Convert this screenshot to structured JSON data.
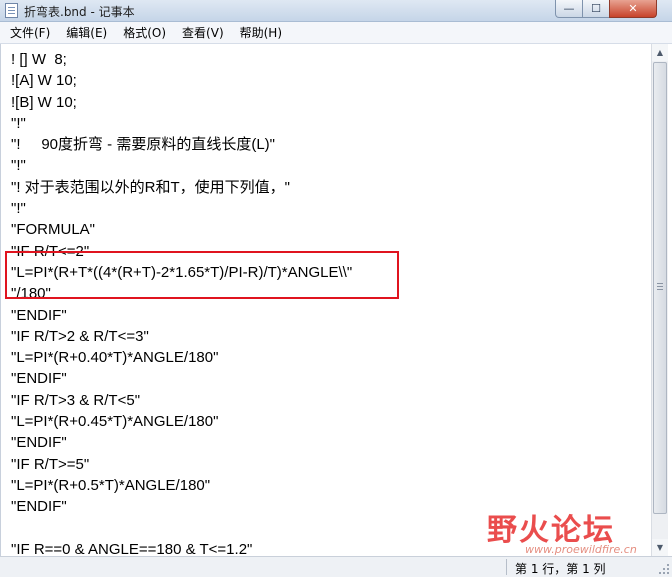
{
  "window": {
    "title": "折弯表.bnd - 记事本",
    "minimize_glyph": "—",
    "maximize_glyph": "☐",
    "close_glyph": "✕"
  },
  "menu": [
    {
      "label": "文件(F)"
    },
    {
      "label": "编辑(E)"
    },
    {
      "label": "格式(O)"
    },
    {
      "label": "查看(V)"
    },
    {
      "label": "帮助(H)"
    }
  ],
  "editor": {
    "lines": [
      "! [] W  8;",
      "![A] W 10;",
      "![B] W 10;",
      "\"!\"",
      "\"!     90度折弯 - 需要原料的直线长度(L)\"",
      "\"!\"",
      "\"! 对于表范围以外的R和T，使用下列值，\"",
      "\"!\"",
      "\"FORMULA\"",
      "\"IF R/T<=2\"",
      "\"L=PI*(R+T*((4*(R+T)-2*1.65*T)/PI-R)/T)*ANGLE\\\\\"",
      "\"/180\"",
      "\"ENDIF\"",
      "\"IF R/T>2 & R/T<=3\"",
      "\"L=PI*(R+0.40*T)*ANGLE/180\"",
      "\"ENDIF\"",
      "\"IF R/T>3 & R/T<5\"",
      "\"L=PI*(R+0.45*T)*ANGLE/180\"",
      "\"ENDIF\"",
      "\"IF R/T>=5\"",
      "\"L=PI*(R+0.5*T)*ANGLE/180\"",
      "\"ENDIF\"",
      "",
      "\"IF R==0 & ANGLE==180 & T<=1.2\""
    ]
  },
  "status": {
    "position": "第 1 行，第 1 列"
  },
  "watermark": {
    "text": "野火论坛",
    "url": "www.proewildfire.cn"
  },
  "colors": {
    "highlight_border": "#e0141f",
    "watermark": "#e83a3a"
  }
}
